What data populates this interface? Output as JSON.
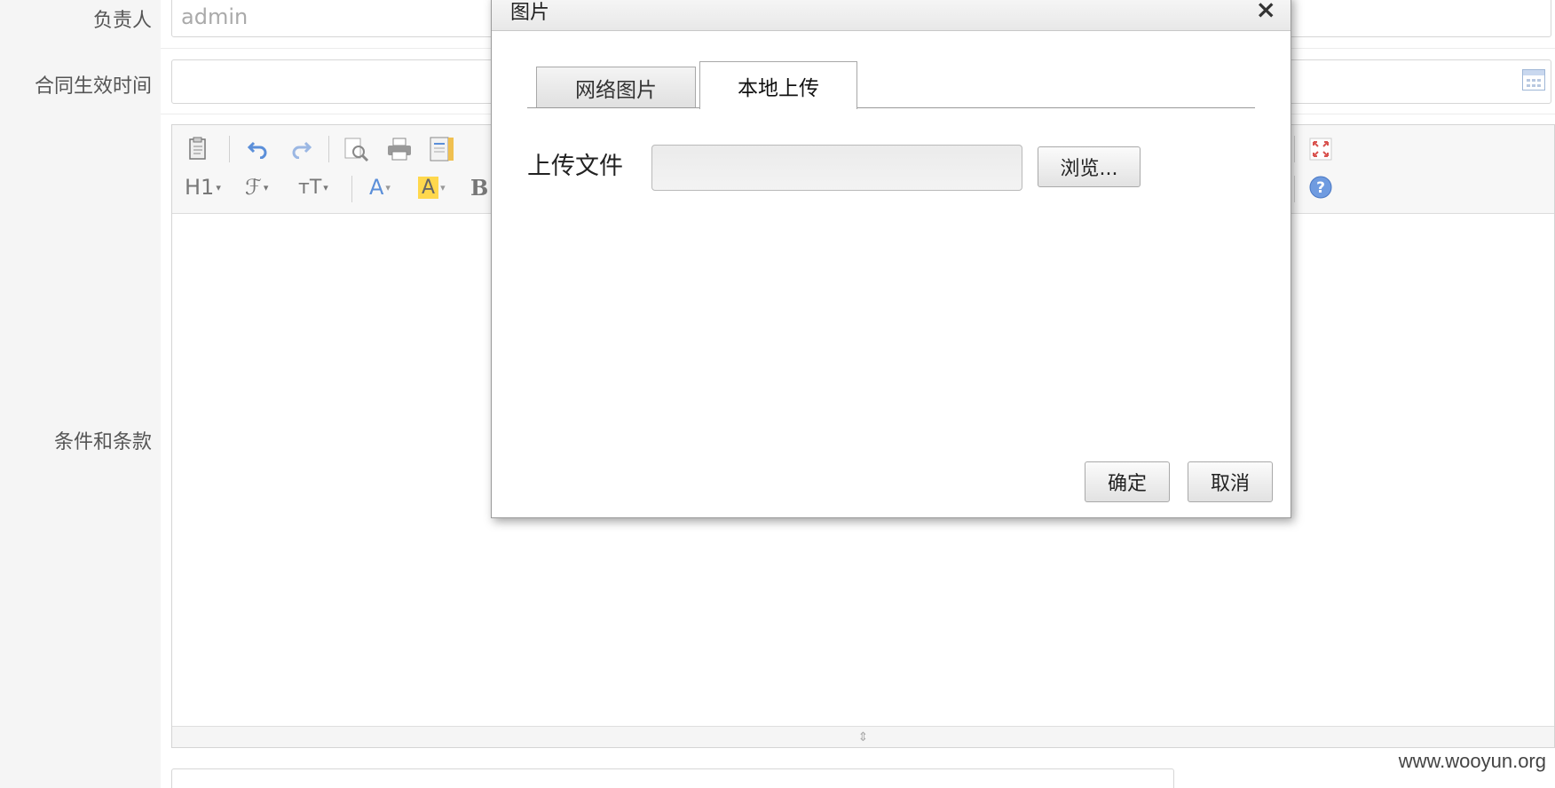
{
  "form": {
    "owner_label": "负责人",
    "owner_value": "admin",
    "effective_time_label": "合同生效时间",
    "effective_time_value": "",
    "terms_label": "条件和条款"
  },
  "editor": {
    "toolbar_row1": [
      "paste-icon",
      "undo-icon",
      "redo-icon",
      "preview-icon",
      "print-icon",
      "template-icon",
      "fullscreen-icon"
    ],
    "toolbar_row2": {
      "heading": "H1",
      "font_family": "ℱ",
      "font_size": "тT",
      "font_color": "A",
      "back_color": "A",
      "bold": "B"
    }
  },
  "dialog": {
    "title": "图片",
    "close": "×",
    "tabs": [
      {
        "label": "网络图片",
        "active": false
      },
      {
        "label": "本地上传",
        "active": true
      }
    ],
    "upload_label": "上传文件",
    "upload_value": "",
    "browse_label": "浏览...",
    "ok_label": "确定",
    "cancel_label": "取消"
  },
  "watermark": "www.wooyun.org",
  "colors": {
    "label_bg": "#f5f5f5",
    "toolbar_bg": "#f7f7f7",
    "icon_blue": "#5b8fd9",
    "highlight_yellow": "#ffd84d",
    "fullscreen_red": "#d9534f"
  }
}
